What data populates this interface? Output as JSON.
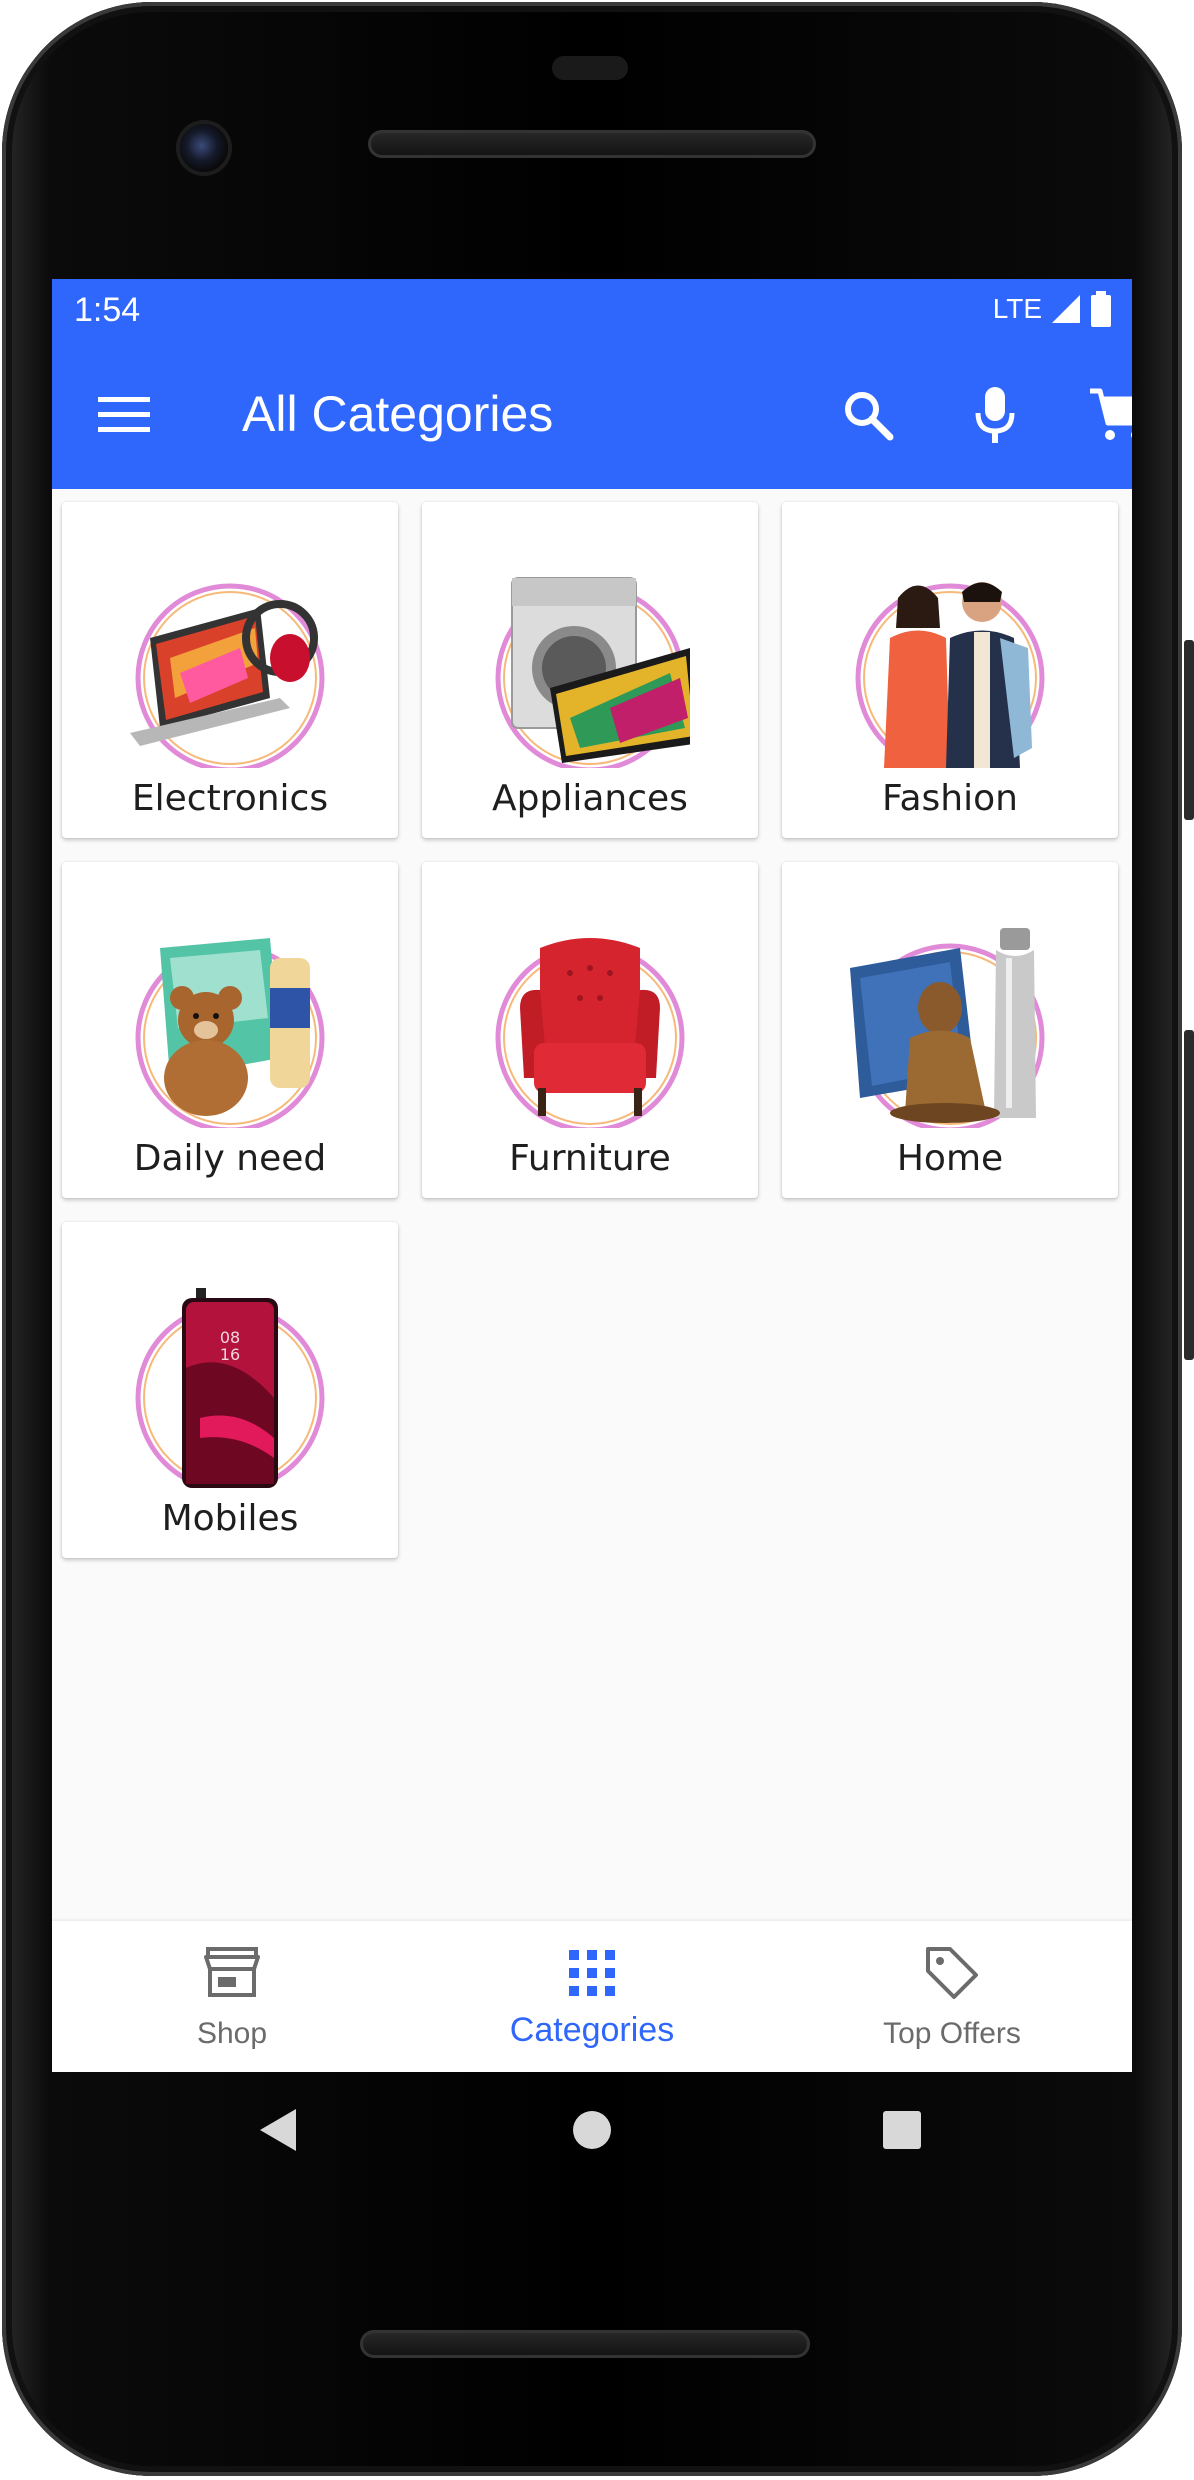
{
  "status_bar": {
    "time": "1:54",
    "network": "LTE"
  },
  "app_bar": {
    "title": "All Categories",
    "menu_icon": "menu-icon",
    "search_icon": "search-icon",
    "mic_icon": "mic-icon",
    "cart_icon": "cart-icon"
  },
  "categories": [
    {
      "label": "Electronics",
      "icon": "laptop-headphones-image"
    },
    {
      "label": "Appliances",
      "icon": "washer-tv-image"
    },
    {
      "label": "Fashion",
      "icon": "fashion-couple-image"
    },
    {
      "label": "Daily need",
      "icon": "teddy-diapers-image"
    },
    {
      "label": "Furniture",
      "icon": "armchair-image"
    },
    {
      "label": "Home",
      "icon": "home-decor-image"
    },
    {
      "label": "Mobiles",
      "icon": "smartphone-image"
    }
  ],
  "bottom_nav": {
    "items": [
      {
        "label": "Shop",
        "icon": "store-icon",
        "active": false
      },
      {
        "label": "Categories",
        "icon": "grid-icon",
        "active": true
      },
      {
        "label": "Top Offers",
        "icon": "tag-icon",
        "active": false
      }
    ]
  },
  "colors": {
    "primary": "#2f66fb",
    "inactive_nav": "#6b6b6b",
    "background": "#fafafa"
  }
}
